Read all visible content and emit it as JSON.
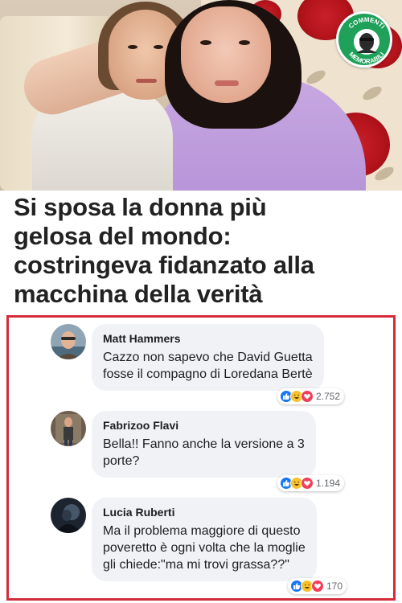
{
  "badge": {
    "top_text": "COMMENTI",
    "bottom_text": "MEMORABILI"
  },
  "headline": {
    "lines": [
      "Si sposa la donna più",
      "gelosa del mondo:",
      "costringeva fidanzato alla",
      "macchina della verità"
    ]
  },
  "comments": [
    {
      "author": "Matt Hammers",
      "lines": [
        "Cazzo non sapevo che David Guetta",
        "fosse il compagno di Loredana Bertè"
      ],
      "reaction_count": "2.752"
    },
    {
      "author": "Fabrizoo Flavi",
      "lines": [
        "Bella!! Fanno anche la versione a 3",
        "porte?"
      ],
      "reaction_count": "1.194"
    },
    {
      "author": "Lucia Ruberti",
      "lines": [
        "Ma il problema maggiore di  questo",
        "poveretto è ogni volta che la moglie",
        "gli chiede:\"ma mi trovi grassa??\""
      ],
      "reaction_count": "170"
    }
  ],
  "colors": {
    "frame": "#d62b3a",
    "bubble": "#f0f2f5",
    "like": "#1877f2",
    "haha": "#f7c22b",
    "love": "#f33e58",
    "badge": "#1fa15a"
  },
  "icons": [
    "like-icon",
    "haha-icon",
    "love-icon"
  ]
}
